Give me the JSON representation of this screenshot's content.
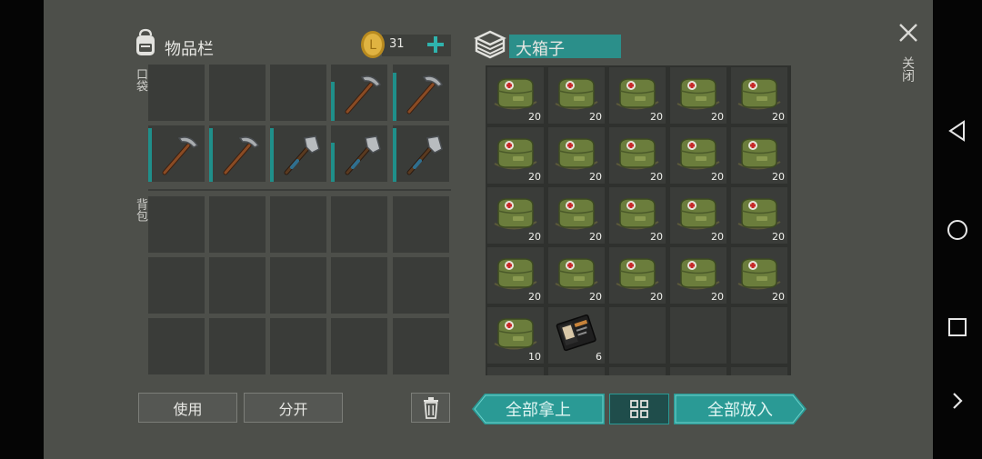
{
  "inventory": {
    "title": "物品栏",
    "coins": "31",
    "pocket_label": "口袋",
    "backpack_label": "背包",
    "pocket_slots": [
      {
        "item": "",
        "count": "",
        "durability": 0
      },
      {
        "item": "",
        "count": "",
        "durability": 0
      },
      {
        "item": "",
        "count": "",
        "durability": 0
      },
      {
        "item": "pickaxe",
        "count": "",
        "durability": 0.7
      },
      {
        "item": "pickaxe",
        "count": "",
        "durability": 0.85
      },
      {
        "item": "pickaxe",
        "count": "",
        "durability": 0.95
      },
      {
        "item": "pickaxe",
        "count": "",
        "durability": 0.95
      },
      {
        "item": "hatchet",
        "count": "",
        "durability": 0.95
      },
      {
        "item": "hatchet",
        "count": "",
        "durability": 0.7
      },
      {
        "item": "hatchet",
        "count": "",
        "durability": 0.95
      }
    ],
    "backpack_slots": 15,
    "use_label": "使用",
    "split_label": "分开"
  },
  "box": {
    "title": "大箱子",
    "slots": [
      {
        "item": "medkit",
        "count": "20"
      },
      {
        "item": "medkit",
        "count": "20"
      },
      {
        "item": "medkit",
        "count": "20"
      },
      {
        "item": "medkit",
        "count": "20"
      },
      {
        "item": "medkit",
        "count": "20"
      },
      {
        "item": "medkit",
        "count": "20"
      },
      {
        "item": "medkit",
        "count": "20"
      },
      {
        "item": "medkit",
        "count": "20"
      },
      {
        "item": "medkit",
        "count": "20"
      },
      {
        "item": "medkit",
        "count": "20"
      },
      {
        "item": "medkit",
        "count": "20"
      },
      {
        "item": "medkit",
        "count": "20"
      },
      {
        "item": "medkit",
        "count": "20"
      },
      {
        "item": "medkit",
        "count": "20"
      },
      {
        "item": "medkit",
        "count": "20"
      },
      {
        "item": "medkit",
        "count": "20"
      },
      {
        "item": "medkit",
        "count": "20"
      },
      {
        "item": "medkit",
        "count": "20"
      },
      {
        "item": "medkit",
        "count": "20"
      },
      {
        "item": "medkit",
        "count": "20"
      },
      {
        "item": "medkit",
        "count": "10"
      },
      {
        "item": "book",
        "count": "6"
      },
      {
        "item": "",
        "count": ""
      },
      {
        "item": "",
        "count": ""
      },
      {
        "item": "",
        "count": ""
      }
    ],
    "take_all_label": "全部拿上",
    "put_all_label": "全部放入"
  },
  "close_label": "关闭",
  "icons": {
    "backpack": "backpack-icon",
    "coin": "coin-icon",
    "add": "plus-icon",
    "box": "box-icon",
    "trash": "trash-icon",
    "sort": "sort-icon",
    "close": "close-icon",
    "back": "back-triangle-icon",
    "home": "home-circle-icon",
    "recent": "recent-square-icon",
    "next": "chevron-right-icon"
  },
  "colors": {
    "accent_teal": "#2a9a95",
    "panel_bg": "#4d4f4a",
    "slot_bg": "#3a3c39",
    "durability_bar": "#1f8f8a"
  }
}
